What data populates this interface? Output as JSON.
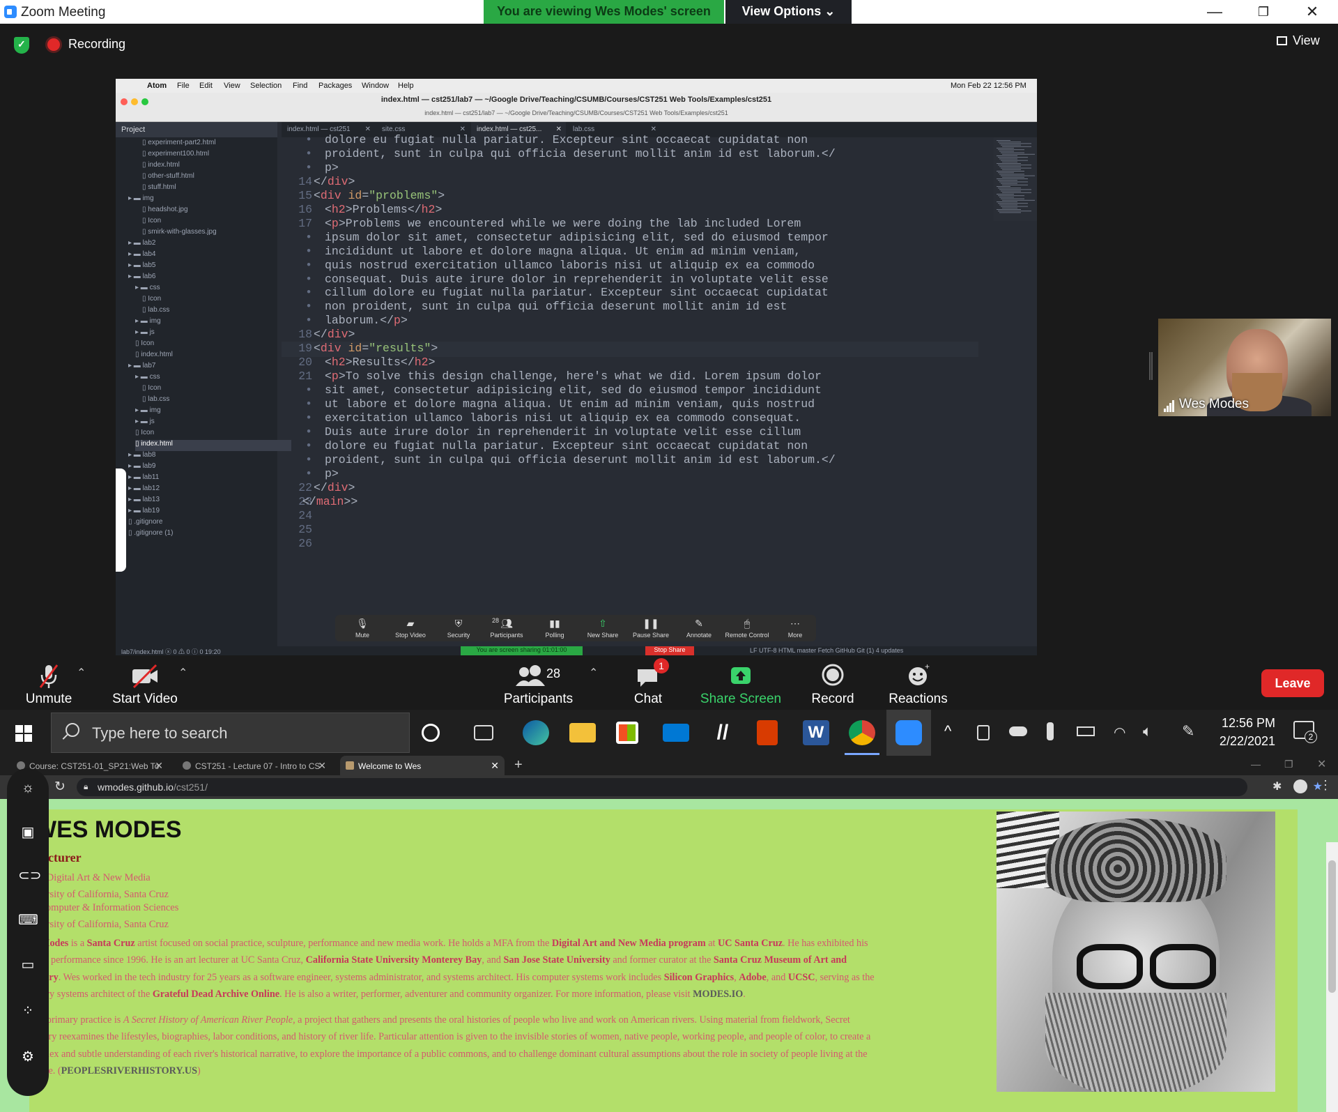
{
  "zoom": {
    "title": "Zoom Meeting",
    "banner": "You are viewing Wes Modes' screen",
    "view_options": "View Options ⌄",
    "recording": "Recording",
    "view": "View",
    "participant_name": "Wes Modes",
    "toolbar": {
      "unmute": "Unmute",
      "start_video": "Start Video",
      "participants": "Participants",
      "participants_count": "28",
      "chat": "Chat",
      "chat_badge": "1",
      "share_screen": "Share Screen",
      "record": "Record",
      "reactions": "Reactions",
      "leave": "Leave"
    }
  },
  "shared_screen": {
    "mac_menu": [
      "Atom",
      "File",
      "Edit",
      "View",
      "Selection",
      "Find",
      "Packages",
      "Window",
      "Help"
    ],
    "mac_clock": "Mon Feb 22  12:56 PM",
    "window_title": "index.html — cst251/lab7 — ~/Google Drive/Teaching/CSUMB/Courses/CST251 Web Tools/Examples/cst251",
    "window_subtitle": "index.html — cst251/lab7 — ~/Google Drive/Teaching/CSUMB/Courses/CST251 Web Tools/Examples/cst251",
    "tree_header": "Project",
    "tree": [
      "experiment-part2.html",
      "experiment100.html",
      "index.html",
      "other-stuff.html",
      "stuff.html",
      "img",
      "headshot.jpg",
      "Icon",
      "smirk-with-glasses.jpg",
      "lab2",
      "lab4",
      "lab5",
      "lab6",
      "css",
      "Icon",
      "lab.css",
      "img",
      "js",
      "Icon",
      "index.html",
      "lab7",
      "css",
      "Icon",
      "lab.css",
      "img",
      "js",
      "Icon",
      "index.html",
      "lab8",
      "lab9",
      "lab11",
      "lab12",
      "lab13",
      "lab19",
      ".gitignore",
      ".gitignore (1)"
    ],
    "tabs": [
      "index.html — cst251",
      "site.css",
      "index.html — cst25...",
      "lab.css"
    ],
    "code_lines": [
      {
        "n": "•",
        "t": "dolore eu fugiat nulla pariatur. Excepteur sint occaecat cupidatat non"
      },
      {
        "n": "•",
        "t": "proident, sunt in culpa qui officia deserunt mollit anim id est laborum.</"
      },
      {
        "n": "•",
        "t": "p>"
      },
      {
        "n": "14",
        "t": "</div>"
      },
      {
        "n": "15",
        "t": "<div id=\"problems\">"
      },
      {
        "n": "16",
        "t": "<h2>Problems</h2>"
      },
      {
        "n": "17",
        "t": "<p>Problems we encountered while we were doing the lab included Lorem"
      },
      {
        "n": "•",
        "t": "ipsum dolor sit amet, consectetur adipisicing elit, sed do eiusmod tempor"
      },
      {
        "n": "•",
        "t": "incididunt ut labore et dolore magna aliqua. Ut enim ad minim veniam,"
      },
      {
        "n": "•",
        "t": "quis nostrud exercitation ullamco laboris nisi ut aliquip ex ea commodo"
      },
      {
        "n": "•",
        "t": "consequat. Duis aute irure dolor in reprehenderit in voluptate velit esse"
      },
      {
        "n": "•",
        "t": "cillum dolore eu fugiat nulla pariatur. Excepteur sint occaecat cupidatat"
      },
      {
        "n": "•",
        "t": "non proident, sunt in culpa qui officia deserunt mollit anim id est"
      },
      {
        "n": "•",
        "t": "laborum.</p>"
      },
      {
        "n": "18",
        "t": "</div>"
      },
      {
        "n": "19",
        "t": "<div id=\"results\">"
      },
      {
        "n": "20",
        "t": "<h2>Results</h2>"
      },
      {
        "n": "21",
        "t": "<p>To solve this design challenge, here's what we did. Lorem ipsum dolor"
      },
      {
        "n": "•",
        "t": "sit amet, consectetur adipisicing elit, sed do eiusmod tempor incididunt"
      },
      {
        "n": "•",
        "t": "ut labore et dolore magna aliqua. Ut enim ad minim veniam, quis nostrud"
      },
      {
        "n": "•",
        "t": "exercitation ullamco laboris nisi ut aliquip ex ea commodo consequat."
      },
      {
        "n": "•",
        "t": "Duis aute irure dolor in reprehenderit in voluptate velit esse cillum"
      },
      {
        "n": "•",
        "t": "dolore eu fugiat nulla pariatur. Excepteur sint occaecat cupidatat non"
      },
      {
        "n": "•",
        "t": "proident, sunt in culpa qui officia deserunt mollit anim id est laborum.</"
      },
      {
        "n": "•",
        "t": "p>"
      },
      {
        "n": "22",
        "t": "</div>"
      },
      {
        "n": "23",
        "t": "</main>>"
      },
      {
        "n": "24",
        "t": ""
      },
      {
        "n": "25",
        "t": ""
      },
      {
        "n": "26",
        "t": ""
      }
    ],
    "share_bar": [
      "Mute",
      "Stop Video",
      "Security",
      "Participants",
      "Polling",
      "New Share",
      "Pause Share",
      "Annotate",
      "Remote Control",
      "More"
    ],
    "share_bar_count": "28",
    "status_left": "lab7/index.html   ⓧ 0 ⚠ 0 ⓘ 0   19:20",
    "sharing_pill": "You are screen sharing   01:01:00",
    "stop_share": "Stop Share",
    "status_right": "LF   UTF-8   HTML   master   Fetch   GitHub   Git (1)   4 updates"
  },
  "taskbar": {
    "search_placeholder": "Type here to search",
    "time": "12:56 PM",
    "date": "2/22/2021",
    "notification_count": "2"
  },
  "browser": {
    "tabs": [
      "Course: CST251-01_SP21:Web To",
      "CST251 - Lecture 07 - Intro to CS",
      "Welcome to Wes"
    ],
    "url_host": "wmodes.github.io",
    "url_path": "/cst251/",
    "page": {
      "name": "WES MODES",
      "role": "Lecturer",
      "edu1_line1": "A, Digital Art & New Media",
      "edu1_line2": "iversity of California, Santa Cruz",
      "edu2_line1": ", Computer & Information Sciences",
      "edu2_line2": "iversity of California, Santa Cruz",
      "bio1_a": "s Modes",
      "bio1_b": " is a ",
      "bio1_c": "Santa Cruz",
      "bio1_d": " artist focused on social practice, sculpture, performance and new media work. He holds a MFA from the ",
      "bio1_e": "Digital Art and New Media program",
      "bio1_f": " at ",
      "bio1_g": "UC Santa Cruz",
      "bio1_h": ". He has exhibited his",
      "bio2_a": "and performance since 1996. He is an art lecturer at UC Santa Cruz, ",
      "bio2_b": "California State University Monterey Bay",
      "bio2_c": ", and ",
      "bio2_d": "San Jose State University",
      "bio2_e": " and former curator at the ",
      "bio2_f": "Santa Cruz Museum of Art and",
      "bio3_a": "istory",
      "bio3_b": ". Wes worked in the tech industry for 25 years as a software engineer, systems administrator, and systems architect. His computer systems work includes ",
      "bio3_c": "Silicon Graphics",
      "bio3_d": ", ",
      "bio3_e": "Adobe",
      "bio3_f": ", and ",
      "bio3_g": "UCSC",
      "bio3_h": ", serving as the",
      "bio4_a": "mary systems architect of the ",
      "bio4_b": "Grateful Dead Archive Online",
      "bio4_c": ". He is also a writer, performer, adventurer and community organizer. For more information, please visit ",
      "bio4_d": "MODES.IO",
      "bio4_e": ".",
      "bio5_a": "es' primary practice is ",
      "bio5_b": "A Secret History of American River People",
      "bio5_c": ", a project that gathers and presents the oral histories of people who live and work on American rivers. Using material from fieldwork, Secret",
      "bio6": "istory reexamines the lifestyles, biographies, labor conditions, and history of river life. Particular attention is given to the invisible stories of women, native people, working people, and people of color, to create a",
      "bio7": "mplex and subtle understanding of each river's historical narrative, to explore the importance of a public commons, and to challenge dominant cultural assumptions about the role in society of people living at the",
      "bio8_a": "ange. (",
      "bio8_b": "PEOPLESRIVERHISTORY.US",
      "bio8_c": ")"
    }
  }
}
